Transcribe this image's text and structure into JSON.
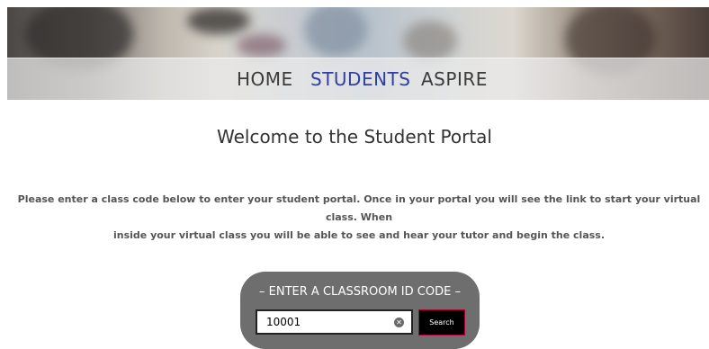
{
  "nav": {
    "items": [
      {
        "label": "HOME"
      },
      {
        "label": "STUDENTS"
      },
      {
        "label": "ASPIRE"
      }
    ],
    "active_color": "#2f3f9e",
    "text_color": "#3b3b3b"
  },
  "main": {
    "title": "Welcome to the Student Portal",
    "intro_line1": "Please enter a class code below to enter your student portal. Once in your portal you will see the link to start your virtual class. When",
    "intro_line2": "inside your virtual class you will be able to see and hear your tutor and begin the class."
  },
  "classroom": {
    "label": "– ENTER A CLASSROOM ID CODE –",
    "input_value": "10001",
    "clear_icon": "clear-circle-icon",
    "search_label": "Search",
    "box_color": "#6e6e6e"
  }
}
